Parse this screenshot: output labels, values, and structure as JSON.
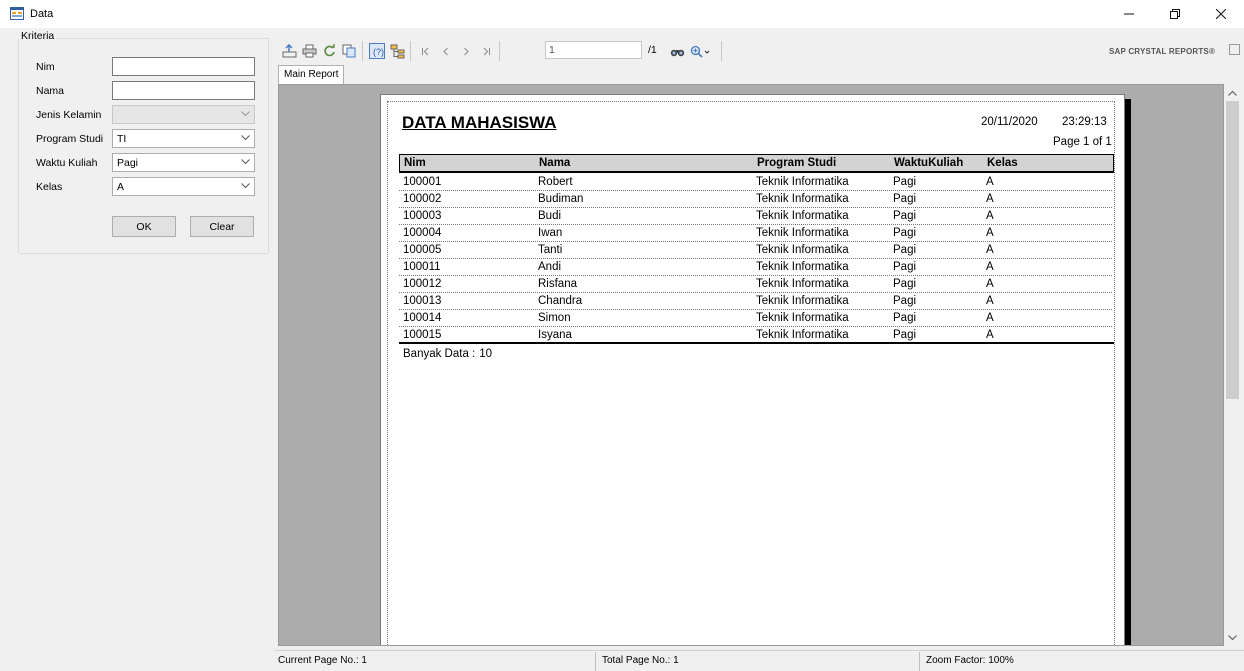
{
  "window": {
    "title": "Data"
  },
  "criteria": {
    "legend": "Kriteria",
    "fields": {
      "nim": {
        "label": "Nim",
        "value": ""
      },
      "nama": {
        "label": "Nama",
        "value": ""
      },
      "jenis_kelamin": {
        "label": "Jenis Kelamin",
        "value": ""
      },
      "program_studi": {
        "label": "Program Studi",
        "value": "TI"
      },
      "waktu_kuliah": {
        "label": "Waktu Kuliah",
        "value": "Pagi"
      },
      "kelas": {
        "label": "Kelas",
        "value": "A"
      }
    },
    "ok_label": "OK",
    "clear_label": "Clear"
  },
  "viewer": {
    "page_input": "1",
    "page_total": "/1",
    "brand": "SAP CRYSTAL REPORTS®",
    "tab_label": "Main Report",
    "icons": [
      "export-icon",
      "print-icon",
      "refresh-icon",
      "copy-icon",
      "help-icon",
      "group-tree-icon",
      "first-page-icon",
      "prev-page-icon",
      "next-page-icon",
      "last-page-icon",
      "find-icon",
      "zoom-icon"
    ]
  },
  "report": {
    "title": "DATA MAHASISWA",
    "date": "20/11/2020",
    "time": "23:29:13",
    "page_label": "Page 1 of 1",
    "columns": {
      "nim": "Nim",
      "nama": "Nama",
      "prodi": "Program Studi",
      "waktu": "WaktuKuliah",
      "kelas": "Kelas"
    },
    "rows": [
      {
        "nim": "100001",
        "nama": "Robert",
        "prodi": "Teknik Informatika",
        "waktu": "Pagi",
        "kelas": "A"
      },
      {
        "nim": "100002",
        "nama": "Budiman",
        "prodi": "Teknik Informatika",
        "waktu": "Pagi",
        "kelas": "A"
      },
      {
        "nim": "100003",
        "nama": "Budi",
        "prodi": "Teknik Informatika",
        "waktu": "Pagi",
        "kelas": "A"
      },
      {
        "nim": "100004",
        "nama": "Iwan",
        "prodi": "Teknik Informatika",
        "waktu": "Pagi",
        "kelas": "A"
      },
      {
        "nim": "100005",
        "nama": "Tanti",
        "prodi": "Teknik Informatika",
        "waktu": "Pagi",
        "kelas": "A"
      },
      {
        "nim": "100011",
        "nama": "Andi",
        "prodi": "Teknik Informatika",
        "waktu": "Pagi",
        "kelas": "A"
      },
      {
        "nim": "100012",
        "nama": "Risfana",
        "prodi": "Teknik Informatika",
        "waktu": "Pagi",
        "kelas": "A"
      },
      {
        "nim": "100013",
        "nama": "Chandra",
        "prodi": "Teknik Informatika",
        "waktu": "Pagi",
        "kelas": "A"
      },
      {
        "nim": "100014",
        "nama": "Simon",
        "prodi": "Teknik Informatika",
        "waktu": "Pagi",
        "kelas": "A"
      },
      {
        "nim": "100015",
        "nama": "Isyana",
        "prodi": "Teknik Informatika",
        "waktu": "Pagi",
        "kelas": "A"
      }
    ],
    "summary_label": "Banyak Data :",
    "summary_value": "10"
  },
  "status": {
    "current_page": "Current Page No.: 1",
    "total_page": "Total Page No.: 1",
    "zoom": "Zoom Factor: 100%"
  }
}
